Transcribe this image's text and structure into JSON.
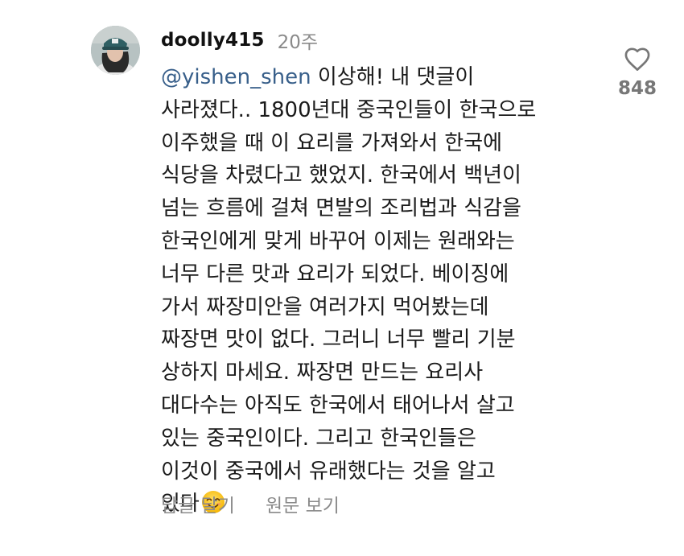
{
  "comment": {
    "username": "doolly415",
    "timestamp": "20주",
    "mention": "@yishen_shen",
    "lines": [
      " 이상해! 내 댓글이",
      "사라졌다.. 1800년대 중국인들이 한국으로",
      "이주했을 때 이 요리를 가져와서 한국에",
      "식당을 차렸다고 했었지. 한국에서 백년이",
      "넘는 흐름에 걸쳐 면발의 조리법과 식감을",
      "한국인에게 맞게 바꾸어 이제는 원래와는",
      "너무 다른 맛과 요리가 되었다. 베이징에",
      "가서 짜장미안을 여러가지 먹어봤는데",
      "짜장면 맛이 없다. 그러니 너무 빨리 기분",
      "상하지 마세요. 짜장면 만드는 요리사",
      "대다수는 아직도 한국에서 태어나서 살고",
      "있는 중국인이다. 그리고 한국인들은",
      "이것이 중국에서 유래했다는 것을 알고",
      "있다"
    ],
    "emoji": "smiling-face-with-smiling-eyes",
    "like_icon": "heart-outline-icon",
    "like_count": "848",
    "actions": {
      "reply": "답글 달기",
      "view_original": "원문 보기"
    }
  },
  "colors": {
    "mention": "#385f8a",
    "muted": "#8a8a8a",
    "text": "#1a1a1a"
  }
}
